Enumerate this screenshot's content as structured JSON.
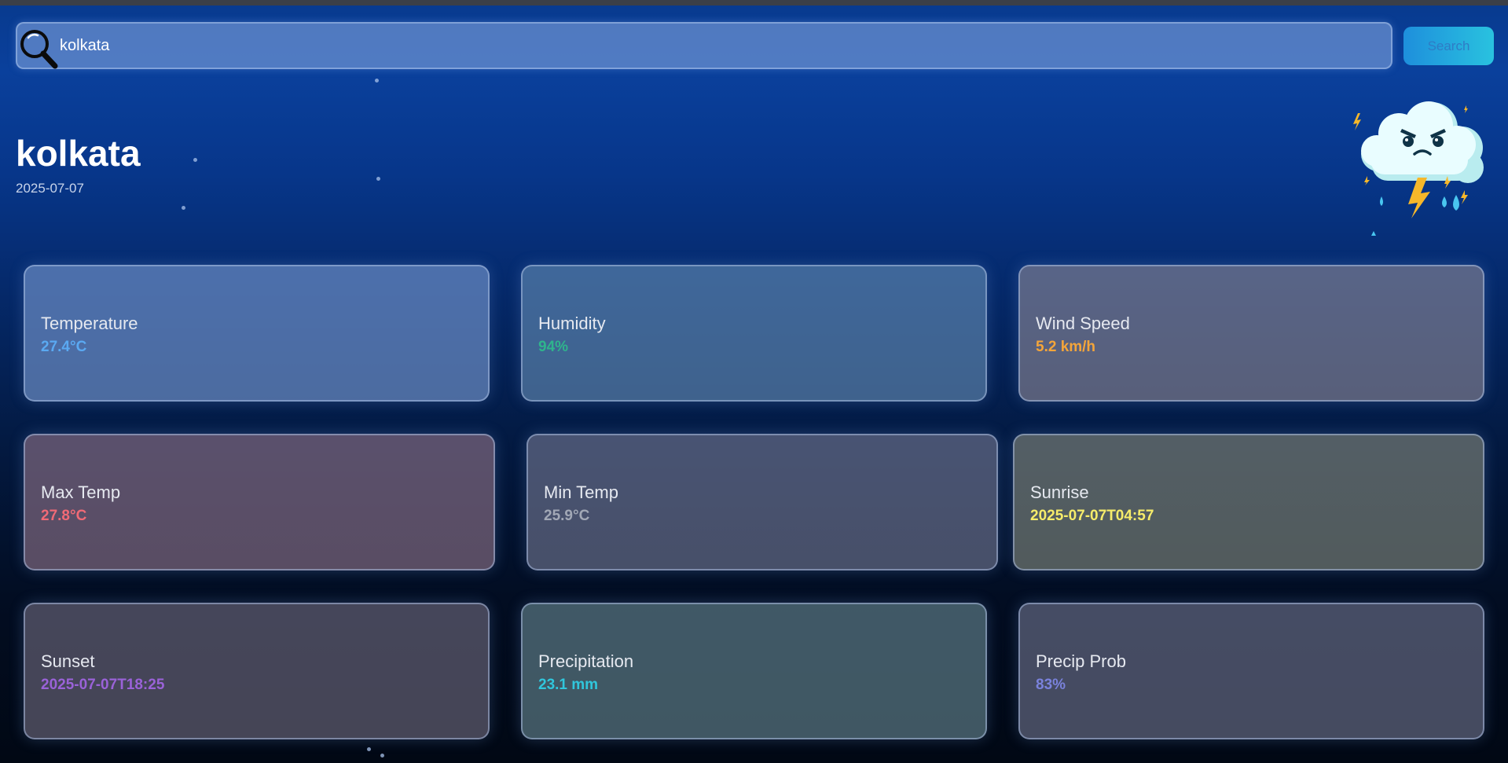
{
  "search": {
    "value": "kolkata",
    "button_label": "Search",
    "icon": "search-icon"
  },
  "location": {
    "city": "kolkata",
    "date": "2025-07-07"
  },
  "weather_icon": "thunderstorm-cloud-icon",
  "cards": [
    {
      "label": "Temperature",
      "value": "27.4°C",
      "color": "#5aa9f2",
      "bg": "rgba(110,145,200,0.68)"
    },
    {
      "label": "Humidity",
      "value": "94%",
      "color": "#2fb48c",
      "bg": "rgba(100,140,180,0.62)"
    },
    {
      "label": "Wind Speed",
      "value": "5.2 km/h",
      "color": "#f4a53a",
      "bg": "rgba(140,135,150,0.62)"
    },
    {
      "label": "Max Temp",
      "value": "27.8°C",
      "color": "#f06a76",
      "bg": "rgba(135,110,130,0.66)"
    },
    {
      "label": "Min Temp",
      "value": "25.9°C",
      "color": "#a2a8b6",
      "bg": "rgba(115,120,145,0.62)"
    },
    {
      "label": "Sunrise",
      "value": "2025-07-07T04:57",
      "color": "#f6ec6a",
      "bg": "rgba(125,130,120,0.66)"
    },
    {
      "label": "Sunset",
      "value": "2025-07-07T18:25",
      "color": "#9a62d8",
      "bg": "rgba(105,100,120,0.66)"
    },
    {
      "label": "Precipitation",
      "value": "23.1 mm",
      "color": "#30c6dc",
      "bg": "rgba(95,125,135,0.68)"
    },
    {
      "label": "Precip Prob",
      "value": "83%",
      "color": "#7a82dc",
      "bg": "rgba(105,110,135,0.66)"
    }
  ]
}
